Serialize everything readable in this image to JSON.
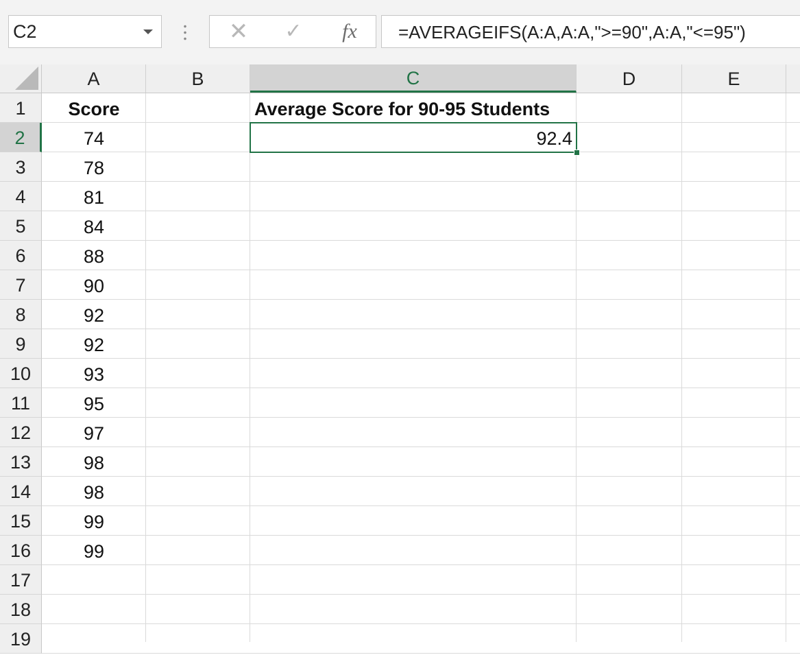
{
  "formula_bar": {
    "name_box": "C2",
    "cancel_icon": "✕",
    "confirm_icon": "✓",
    "fx_label": "fx",
    "formula": "=AVERAGEIFS(A:A,A:A,\">=90\",A:A,\"<=95\")"
  },
  "columns": [
    "A",
    "B",
    "C",
    "D",
    "E"
  ],
  "rows": [
    "1",
    "2",
    "3",
    "4",
    "5",
    "6",
    "7",
    "8",
    "9",
    "10",
    "11",
    "12",
    "13",
    "14",
    "15",
    "16",
    "17",
    "18",
    "19"
  ],
  "cells": {
    "A1": "Score",
    "A2": "74",
    "A3": "78",
    "A4": "81",
    "A5": "84",
    "A6": "88",
    "A7": "90",
    "A8": "92",
    "A9": "92",
    "A10": "93",
    "A11": "95",
    "A12": "97",
    "A13": "98",
    "A14": "98",
    "A15": "99",
    "A16": "99",
    "C1": "Average Score for 90-95 Students",
    "C2": "92.4"
  },
  "selected_cell": "C2",
  "colors": {
    "accent": "#217346"
  }
}
